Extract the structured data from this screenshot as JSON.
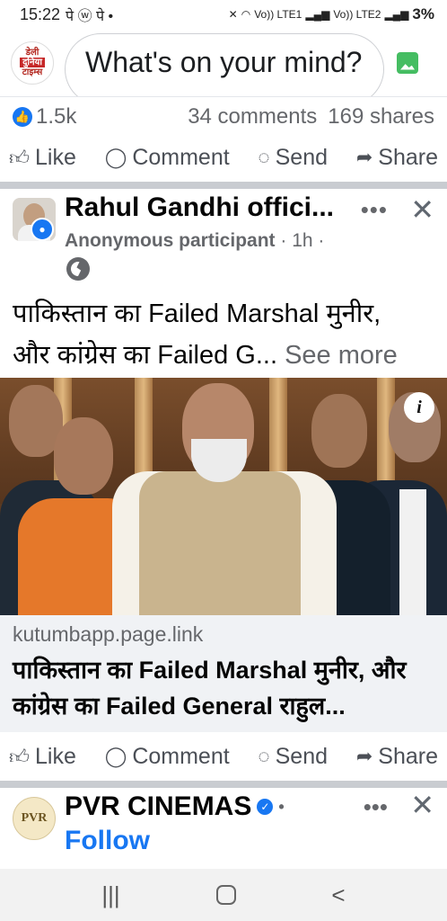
{
  "status_bar": {
    "time": "15:22",
    "notif_left": "पे ⓦ पे •",
    "net_1": "Vo)) LTE1",
    "net_2": "Vo)) LTE2",
    "battery": "3%"
  },
  "composer": {
    "avatar_text_top": "डेली",
    "avatar_text_mid": "दुनिया",
    "avatar_text_bottom": "टाइम्स",
    "placeholder": "What's on your mind?"
  },
  "prev_post": {
    "reactions_count": "1.5k",
    "comments": "34 comments",
    "shares": "169 shares"
  },
  "actions": {
    "like": "Like",
    "comment": "Comment",
    "send": "Send",
    "share": "Share"
  },
  "post": {
    "author": "Rahul Gandhi offici...",
    "participant": "Anonymous participant",
    "time": " · 1h ·",
    "text_line1": "पाकिस्तान का Failed Marshal मुनीर,",
    "text_line2": "और कांग्रेस का Failed G...",
    "see_more": "See more",
    "link_domain": "kutumbapp.page.link",
    "link_title": "पाकिस्तान का Failed Marshal मुनीर, और कांग्रेस का Failed General राहुल..."
  },
  "next_post": {
    "avatar_text": "PVR",
    "author": "PVR CINEMAS",
    "follow": "Follow"
  },
  "nav": {
    "recents": "|||",
    "back": "<"
  }
}
